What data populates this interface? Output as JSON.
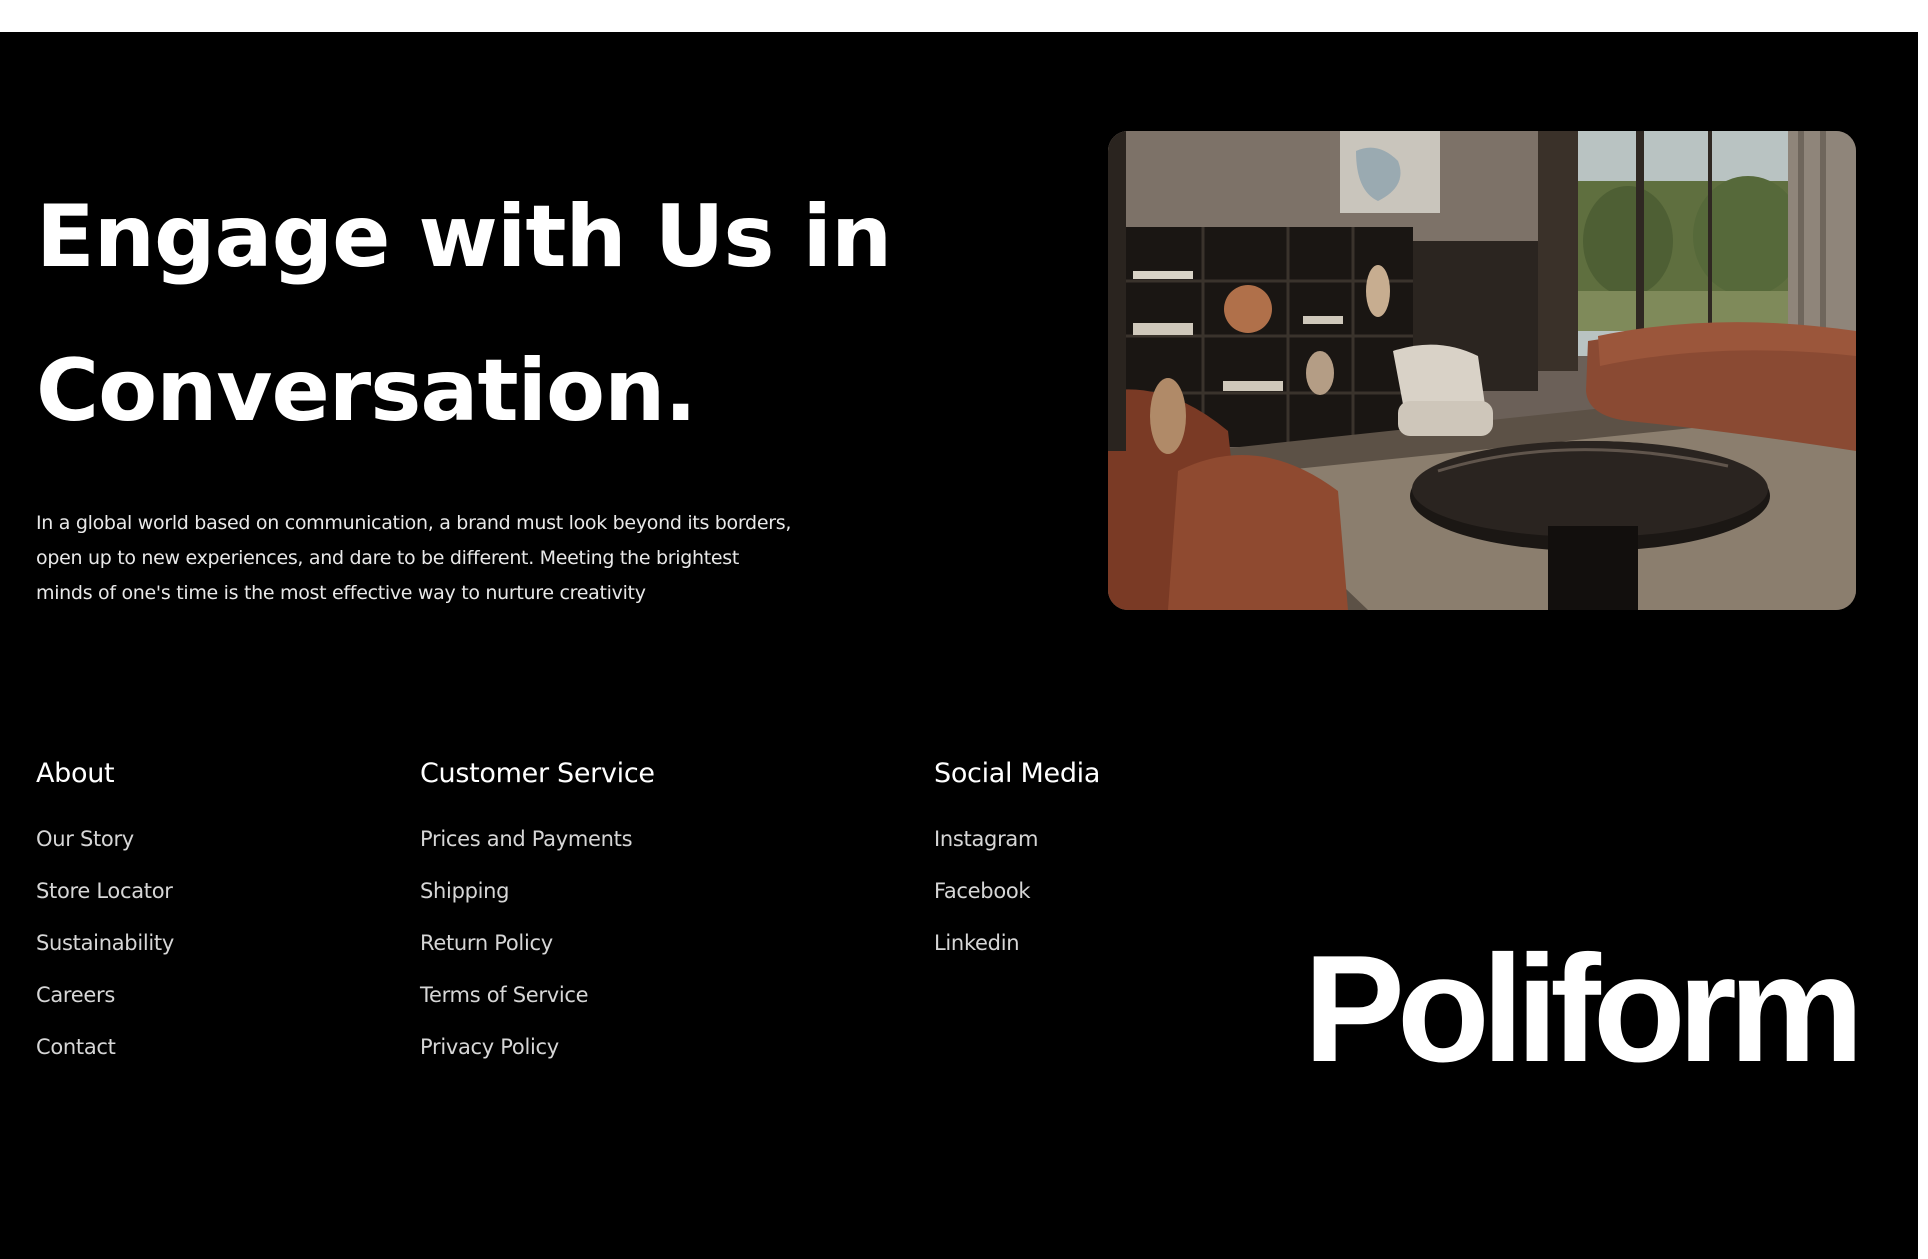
{
  "headline": {
    "line1": "Engage with Us in",
    "line2": "Conversation."
  },
  "intro": {
    "line1": "In a global world based on communication, a brand must look beyond its borders,",
    "line2": "open up to new experiences, and dare to be different. Meeting the brightest",
    "line3": "minds of one's time is the most effective way to nurture creativity"
  },
  "columns": {
    "about": {
      "title": "About",
      "links": [
        "Our Story",
        "Store Locator",
        "Sustainability",
        "Careers",
        "Contact"
      ]
    },
    "service": {
      "title": "Customer Service",
      "links": [
        "Prices and Payments",
        "Shipping",
        "Return Policy",
        "Terms of Service",
        "Privacy Policy"
      ]
    },
    "social": {
      "title": "Social Media",
      "links": [
        "Instagram",
        "Facebook",
        "Linkedin"
      ]
    }
  },
  "brand": {
    "logo": "Poliform"
  },
  "colors": {
    "background": "#000000",
    "text": "#ffffff",
    "link_text": "#d6d6d6"
  },
  "icons": {
    "hero_image": "living-room-photo"
  }
}
